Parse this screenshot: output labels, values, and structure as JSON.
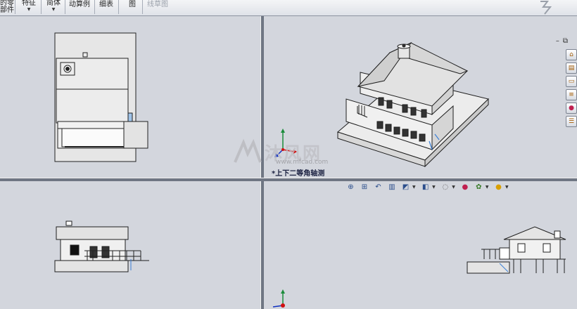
{
  "toolbar": {
    "items": [
      {
        "line1": "的零",
        "line2": "部件",
        "has_arrow": false
      },
      {
        "line1": "特征",
        "line2": "",
        "has_arrow": true
      },
      {
        "line1": "简体",
        "line2": "",
        "has_arrow": true
      },
      {
        "line1": "动算例",
        "line2": "",
        "has_arrow": false
      },
      {
        "line1": "细表",
        "line2": "",
        "has_arrow": false
      },
      {
        "line1": "图",
        "line2": "",
        "has_arrow": false
      },
      {
        "line1": "线草图",
        "line2": "",
        "has_arrow": false,
        "disabled": true
      }
    ]
  },
  "viewports": {
    "top_left": {
      "name": "top-view"
    },
    "top_right": {
      "name": "isometric-view",
      "label": "*上下二等角轴测"
    },
    "bottom_left": {
      "name": "front-view"
    },
    "bottom_right": {
      "name": "right-view"
    }
  },
  "window_controls": {
    "minimize": "–",
    "restore": "⧉"
  },
  "task_pane": [
    "home-icon",
    "library-icon",
    "folder-icon",
    "palette-icon",
    "appearance-icon",
    "custom-props-icon"
  ],
  "hud_toolbar": [
    "zoom-to-fit-icon",
    "zoom-area-icon",
    "previous-view-icon",
    "section-view-icon",
    "view-orientation-icon",
    "display-style-icon",
    "hide-show-icon",
    "edit-appearance-icon",
    "apply-scene-icon",
    "view-settings-icon"
  ],
  "watermark": {
    "text": "沐风网",
    "url": "www.mfcad.com"
  },
  "colors": {
    "viewport_bg": "#d3d6dd",
    "model_fill": "#e9e9e9",
    "model_line": "#1e1e1e",
    "axis_x": "#d01010",
    "axis_y": "#1a8c3a",
    "axis_z": "#1030c0"
  }
}
